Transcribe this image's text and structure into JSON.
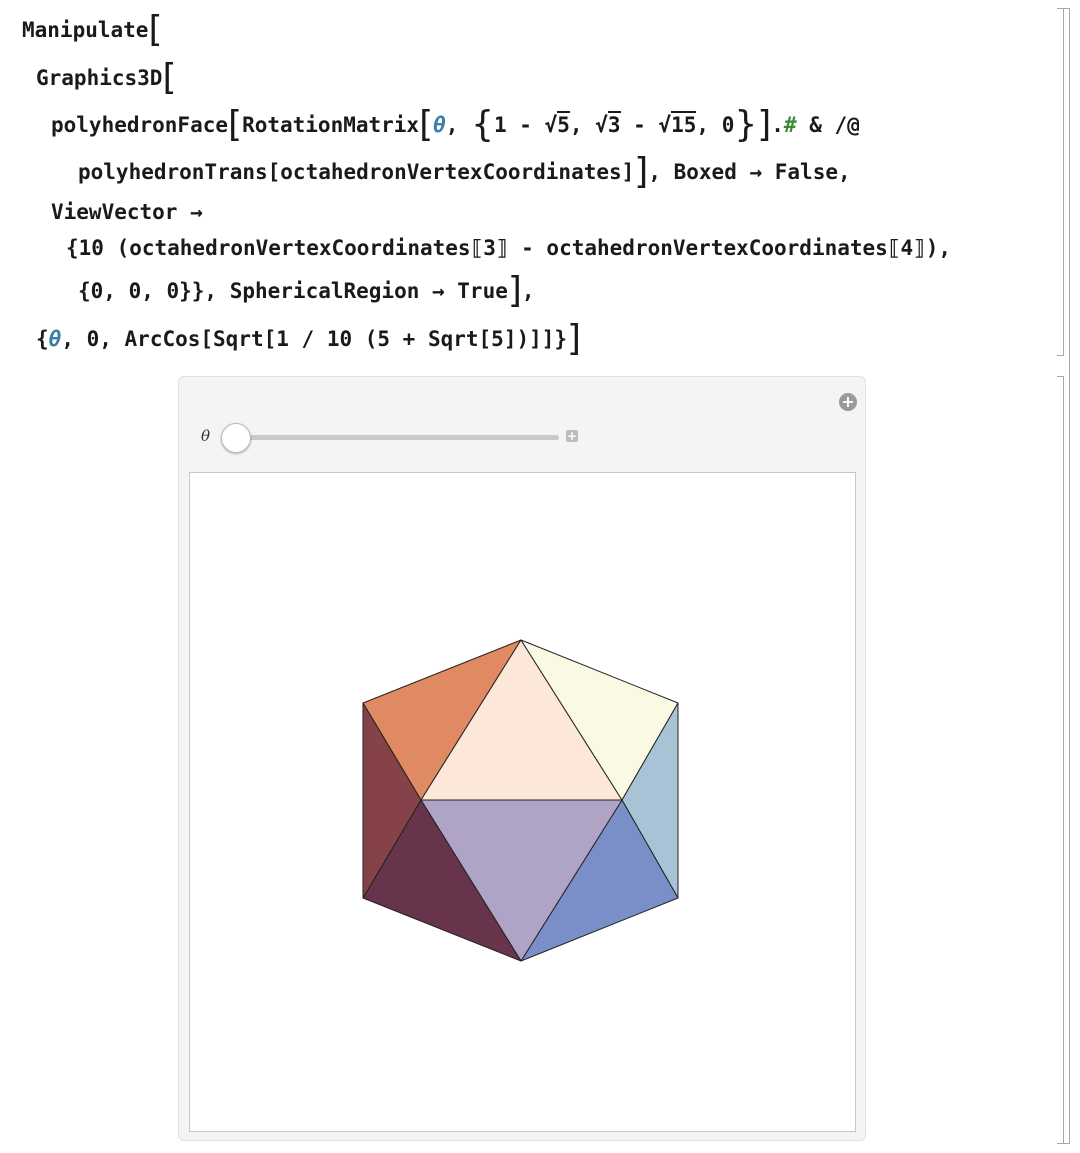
{
  "code": {
    "manipulate": "Manipulate",
    "graphics3d": "Graphics3D",
    "polyhedron_face": "polyhedronFace",
    "rotation_matrix": "RotationMatrix",
    "theta": "θ",
    "comma": ",",
    "one_minus": "1 - ",
    "sqrt5": "5",
    "sqrt3": "3",
    "sqrt15": "15",
    "zero": "0",
    "dot_slot": ".",
    "slot": "#",
    "amp_map": " & /@",
    "trans_line": "polyhedronTrans[octahedronVertexCoordinates]",
    "boxed": ", Boxed → False,",
    "viewvector": "ViewVector →",
    "vv_expr": "{10 (octahedronVertexCoordinates⟦3⟧ - octahedronVertexCoordinates⟦4⟧),",
    "vv_end": "{0, 0, 0}}, SphericalRegion → True",
    "close_comma": ",",
    "range_open": "{",
    "range_rest": ", 0, ArcCos[Sqrt[1 / 10 (5 + Sqrt[5])]]}"
  },
  "control": {
    "label": "θ",
    "value": 0.0
  },
  "colors": {
    "face_top_left": "#df8a63",
    "face_top_center": "#fde7d9",
    "face_top_right": "#fafae4",
    "face_right_upper": "#a8c2d6",
    "face_right_lower": "#7a8fc8",
    "face_bottom_center": "#afa4c6",
    "face_bottom_left": "#68344c",
    "face_left_upper": "#854248"
  }
}
